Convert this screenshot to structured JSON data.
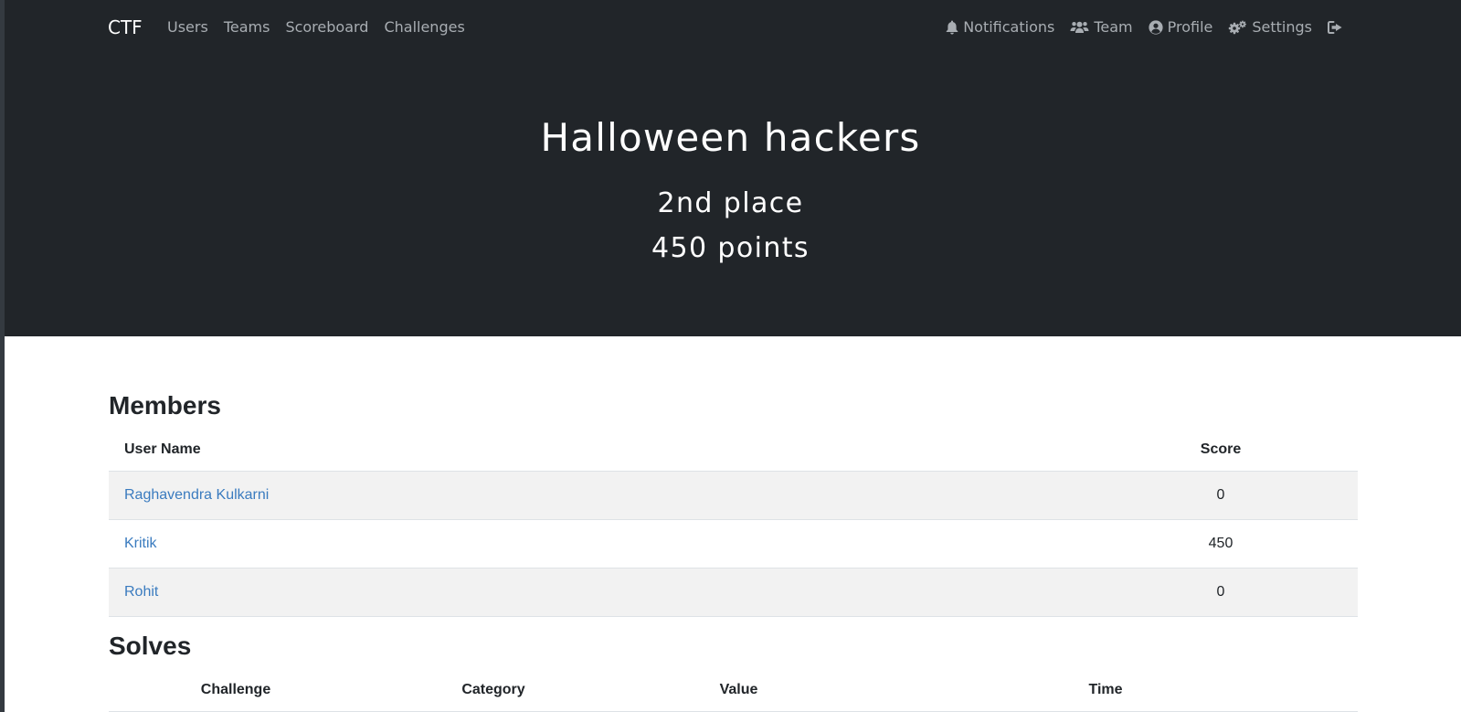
{
  "navbar": {
    "brand": "CTF",
    "left_links": [
      {
        "label": "Users"
      },
      {
        "label": "Teams"
      },
      {
        "label": "Scoreboard"
      },
      {
        "label": "Challenges"
      }
    ],
    "right_links": [
      {
        "label": "Notifications",
        "icon": "bell-icon"
      },
      {
        "label": "Team",
        "icon": "users-icon"
      },
      {
        "label": "Profile",
        "icon": "user-circle-icon"
      },
      {
        "label": "Settings",
        "icon": "cogs-icon"
      }
    ],
    "logout_icon": "sign-out-icon"
  },
  "hero": {
    "team_name": "Halloween hackers",
    "place": "2nd place",
    "points": "450 points"
  },
  "members": {
    "title": "Members",
    "columns": [
      "User Name",
      "Score"
    ],
    "rows": [
      {
        "name": "Raghavendra Kulkarni",
        "score": "0"
      },
      {
        "name": "Kritik",
        "score": "450"
      },
      {
        "name": "Rohit",
        "score": "0"
      }
    ]
  },
  "solves": {
    "title": "Solves",
    "columns": [
      "Challenge",
      "Category",
      "Value",
      "Time"
    ]
  },
  "colors": {
    "header_bg": "#212529",
    "link": "#3a7bbf",
    "stripe": "#f2f2f2"
  }
}
